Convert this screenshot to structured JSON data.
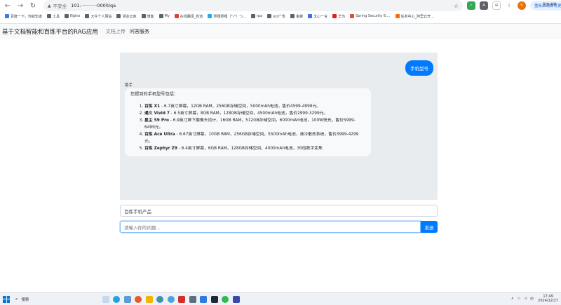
{
  "browser": {
    "insecure_label": "不安全",
    "url": "101.···········0000/qa",
    "update_label": "重新启动即可更新 ⋮",
    "bookmarks": [
      {
        "label": "百度一下，你就知道",
        "color": "#3b7be8"
      },
      {
        "label": "工具",
        "color": "#5f6368"
      },
      {
        "label": "Nginx",
        "color": "#5f6368"
      },
      {
        "label": "大牛个人网站",
        "color": "#5f6368"
      },
      {
        "label": "领业云库",
        "color": "#5f6368"
      },
      {
        "label": "博客",
        "color": "#5f6368"
      },
      {
        "label": "My",
        "color": "#5f6368"
      },
      {
        "label": "在线翻译_有道",
        "color": "#e0402f"
      },
      {
        "label": "师哩师哩（°-°）つ...",
        "color": "#23ade5"
      },
      {
        "label": "rpa",
        "color": "#5f6368"
      },
      {
        "label": "ocr广告",
        "color": "#5f6368"
      },
      {
        "label": "金蝶",
        "color": "#5f6368"
      },
      {
        "label": "文心一言",
        "color": "#3a6ff5"
      },
      {
        "label": "华为",
        "color": "#e31d1c"
      },
      {
        "label": "Spring Security 6....",
        "color": "#e04e39"
      },
      {
        "label": "任务中心_阿里云开...",
        "color": "#ff6a00"
      }
    ],
    "all_bookmarks": "所有书签"
  },
  "app": {
    "brand": "基于文档智能和百炼平台的RAG应用",
    "nav": {
      "upload": "文档上传",
      "qa": "问答服务"
    }
  },
  "chat": {
    "user_message": "手机型号",
    "assistant_label": "助手",
    "assistant_intro": "您提到的手机型号包括：",
    "items": [
      {
        "name": "百炼 X1",
        "desc": " - 6.7英寸屏幕，12GB RAM，256GB存储空间，5000mAh电池，售价4599-4999元。"
      },
      {
        "name": "通义 Vivid 7",
        "desc": " - 6.5英寸屏幕，8GB RAM，128GB存储空间，4500mAh电池，售价2999-3299元。"
      },
      {
        "name": "星尘 S9 Pro",
        "desc": " - 6.9英寸屏下摄像头设计，16GB RAM，512GB存储空间，6000mAh电池，100W快充，售价5999-6499元。"
      },
      {
        "name": "百炼 Ace Ultra",
        "desc": " - 6.67英寸屏幕，10GB RAM，256GB存储空间，5500mAh电池，液冷散热系统，售价3999-4299元。"
      },
      {
        "name": "百炼 Zephyr Z9",
        "desc": " - 6.4英寸屏幕，6GB RAM，128GB存储空间，4000mAh电池，30倍数字变焦"
      }
    ]
  },
  "context_value": "百炼手机产品",
  "question_placeholder": "请输入你的问题...",
  "send_label": "发送",
  "taskbar": {
    "search_label": "搜索",
    "ime": "中",
    "time": "17:49",
    "date": "2024/12/27"
  }
}
